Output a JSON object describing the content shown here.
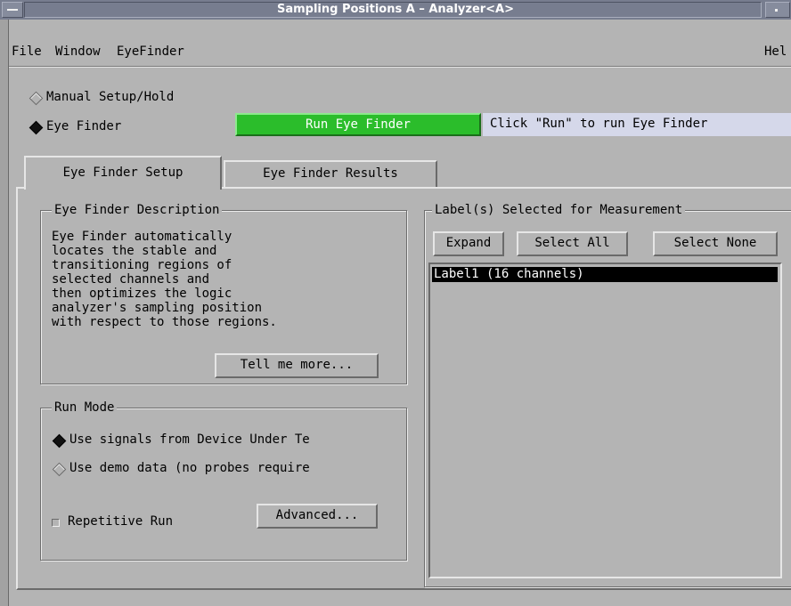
{
  "window": {
    "title": "Sampling Positions A – Analyzer<A>"
  },
  "menu": {
    "file": "File",
    "window": "Window",
    "eyefinder": "EyeFinder",
    "help": "Hel"
  },
  "mode": {
    "manual_label": "Manual Setup/Hold",
    "manual_selected": false,
    "eyefinder_label": "Eye Finder",
    "eyefinder_selected": true,
    "run_button_label": "Run Eye Finder",
    "status_text": "Click \"Run\" to run Eye Finder"
  },
  "colors": {
    "title_bar": "#777d8f",
    "run_button": "#2bbd2b",
    "status_field": "#d5d8ea",
    "background": "#b4b4b4"
  },
  "tabs": [
    {
      "label": "Eye Finder Setup",
      "active": true
    },
    {
      "label": "Eye Finder Results",
      "active": false
    }
  ],
  "description": {
    "legend": "Eye Finder Description",
    "lines": [
      "Eye Finder automatically",
      "locates the stable and",
      "transitioning regions of",
      "selected channels and",
      "then optimizes the logic",
      "analyzer's sampling position",
      "with respect to those regions."
    ],
    "tell_more_label": "Tell me more..."
  },
  "run_mode": {
    "legend": "Run Mode",
    "option_device": "Use signals from Device Under Te",
    "option_device_selected": true,
    "option_demo": "Use demo data (no probes require",
    "option_demo_selected": false,
    "repetitive_label": "Repetitive Run",
    "repetitive_checked": false,
    "advanced_label": "Advanced..."
  },
  "labels_panel": {
    "legend": "Label(s) Selected for Measurement",
    "expand_label": "Expand",
    "select_all_label": "Select All",
    "select_none_label": "Select None",
    "items": [
      {
        "text": "Label1 (16 channels)",
        "selected": true
      }
    ]
  }
}
